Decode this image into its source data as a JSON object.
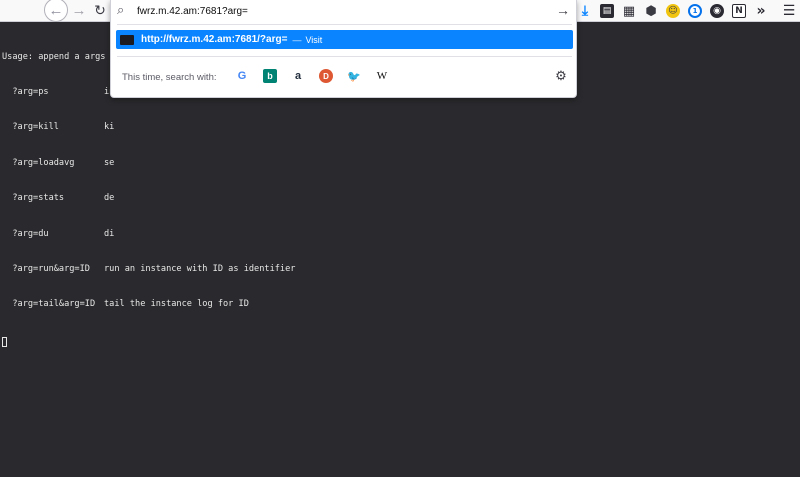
{
  "toolbar": {
    "back_icon": "←",
    "forward_icon": "→",
    "reload_icon": "↻",
    "extensions": [
      {
        "name": "download-icon",
        "glyph": "⤓"
      },
      {
        "name": "pocket-icon",
        "glyph": "▤"
      },
      {
        "name": "grid-icon",
        "glyph": "▦"
      },
      {
        "name": "cube-icon",
        "glyph": "⬢"
      },
      {
        "name": "emoji-face-icon",
        "glyph": "☺"
      },
      {
        "name": "onepassword-icon",
        "glyph": "1"
      },
      {
        "name": "ghost-icon",
        "glyph": "◉"
      },
      {
        "name": "notion-icon",
        "glyph": "N"
      },
      {
        "name": "overflow-chevrons-icon",
        "glyph": "»"
      }
    ],
    "menu_icon": "☰"
  },
  "urlbar": {
    "value": "fwrz.m.42.am:7681?arg=",
    "search_icon": "⌕",
    "go_icon": "→",
    "suggestion": {
      "url": "http://fwrz.m.42.am:7681/?arg=",
      "separator": "—",
      "action": "Visit"
    },
    "search_with_label": "This time, search with:",
    "engines": [
      {
        "name": "google",
        "glyph": "G"
      },
      {
        "name": "bing",
        "glyph": "b"
      },
      {
        "name": "amazon",
        "glyph": "a"
      },
      {
        "name": "duckduckgo",
        "glyph": "D"
      },
      {
        "name": "twitter",
        "glyph": "🐦"
      },
      {
        "name": "wikipedia",
        "glyph": "W"
      }
    ],
    "gear_icon": "⚙"
  },
  "terminal": {
    "lines": [
      {
        "cmd": "Usage: append a args to",
        "desc": ""
      },
      {
        "cmd": "  ?arg=ps",
        "desc": "in"
      },
      {
        "cmd": "  ?arg=kill",
        "desc": "ki"
      },
      {
        "cmd": "  ?arg=loadavg",
        "desc": "se"
      },
      {
        "cmd": "  ?arg=stats",
        "desc": "de"
      },
      {
        "cmd": "  ?arg=du",
        "desc": "di"
      },
      {
        "cmd": "  ?arg=run&arg=ID",
        "desc": "run an instance with ID as identifier"
      },
      {
        "cmd": "  ?arg=tail&arg=ID",
        "desc": "tail the instance log for ID"
      }
    ]
  }
}
